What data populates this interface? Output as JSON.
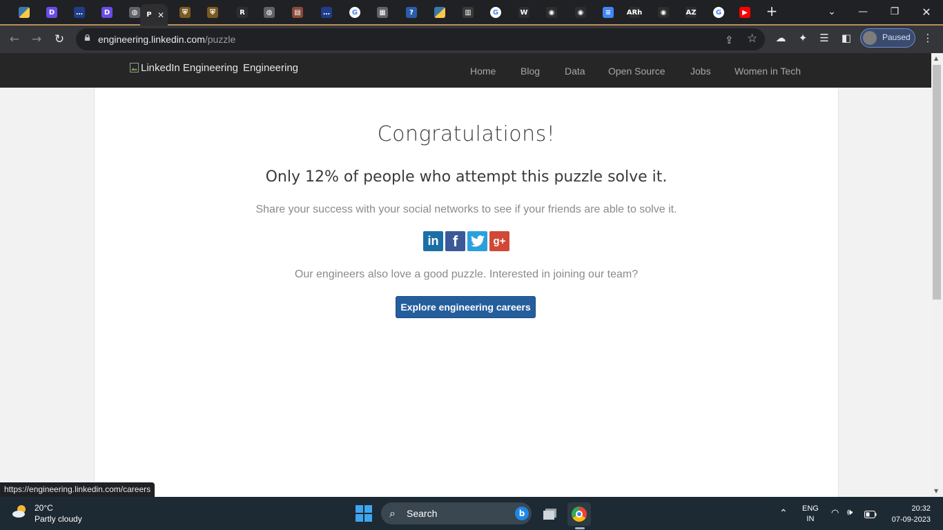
{
  "browser": {
    "tabs": [
      {
        "icon": "python-icon",
        "glyph": "",
        "color": "#3b77a8"
      },
      {
        "icon": "d-app-icon",
        "glyph": "D",
        "color": "#6b4ce6"
      },
      {
        "icon": "dots-app-icon",
        "glyph": "…",
        "color": "#1f3d8a"
      },
      {
        "icon": "d-app-icon",
        "glyph": "D",
        "color": "#6b4ce6"
      },
      {
        "icon": "globe-icon",
        "glyph": "◍",
        "color": "#5f6368"
      },
      {
        "icon": "puzzle-page-icon",
        "glyph": "P",
        "color": "#2e2e30"
      },
      {
        "icon": "shield-site-icon",
        "glyph": "⛨",
        "color": "#7a5a22"
      },
      {
        "icon": "shield-site-icon",
        "glyph": "⛨",
        "color": "#7a5a22"
      },
      {
        "icon": "r-app-icon",
        "glyph": "R",
        "color": "#2e2e30"
      },
      {
        "icon": "globe-icon",
        "glyph": "◍",
        "color": "#5f6368"
      },
      {
        "icon": "card-app-icon",
        "glyph": "▤",
        "color": "#8a4a3a"
      },
      {
        "icon": "dots-app-icon",
        "glyph": "…",
        "color": "#1f3d8a"
      },
      {
        "icon": "google-icon",
        "glyph": "G",
        "color": "#ffffff"
      },
      {
        "icon": "doc-thumb-icon",
        "glyph": "▦",
        "color": "#5f6368"
      },
      {
        "icon": "help-app-icon",
        "glyph": "?",
        "color": "#2a5caa"
      },
      {
        "icon": "python-icon",
        "glyph": "",
        "color": "#3b77a8"
      },
      {
        "icon": "cisco-icon",
        "glyph": "▥",
        "color": "#3a3a3a"
      },
      {
        "icon": "google-icon",
        "glyph": "G",
        "color": "#ffffff"
      },
      {
        "icon": "w-app-icon",
        "glyph": "W",
        "color": "#2e2e30"
      },
      {
        "icon": "github-icon",
        "glyph": "◉",
        "color": "#2e2e30"
      },
      {
        "icon": "github-icon",
        "glyph": "◉",
        "color": "#2e2e30"
      },
      {
        "icon": "google-docs-icon",
        "glyph": "≡",
        "color": "#4285f4"
      },
      {
        "icon": "arh-app-icon",
        "glyph": "ARh",
        "color": "#2e2e30"
      },
      {
        "icon": "github-icon",
        "glyph": "◉",
        "color": "#2e2e30"
      },
      {
        "icon": "az-app-icon",
        "glyph": "AZ",
        "color": "#2e2e30"
      },
      {
        "icon": "google-icon",
        "glyph": "G",
        "color": "#ffffff"
      },
      {
        "icon": "youtube-icon",
        "glyph": "▶",
        "color": "#ff0000"
      }
    ],
    "active_tab_glyph": "P",
    "new_tab_glyph": "+",
    "url_host": "engineering.linkedin.com",
    "url_path": "/puzzle",
    "profile_label": "Paused"
  },
  "site": {
    "logo_alt": "LinkedIn Engineering",
    "logo_label": "Engineering",
    "nav": [
      "Home",
      "Blog",
      "Data",
      "Open Source",
      "Jobs",
      "Women in Tech"
    ]
  },
  "main": {
    "heading": "Congratulations!",
    "subheading": "Only 12% of people who attempt this puzzle solve it.",
    "share_text": "Share your success with your social networks to see if your friends are able to solve it.",
    "social": [
      {
        "icon": "linkedin-icon",
        "glyph": "in"
      },
      {
        "icon": "facebook-icon",
        "glyph": "f"
      },
      {
        "icon": "twitter-icon",
        "glyph": "🐦"
      },
      {
        "icon": "google-plus-icon",
        "glyph": "g+"
      }
    ],
    "careers_text": "Our engineers also love a good puzzle. Interested in joining our team?",
    "cta_label": "Explore engineering careers"
  },
  "status_url": "https://engineering.linkedin.com/careers",
  "taskbar": {
    "temperature": "20°C",
    "weather": "Partly cloudy",
    "search_label": "Search",
    "lang_top": "ENG",
    "lang_bottom": "IN",
    "time": "20:32",
    "date": "07-09-2023"
  }
}
